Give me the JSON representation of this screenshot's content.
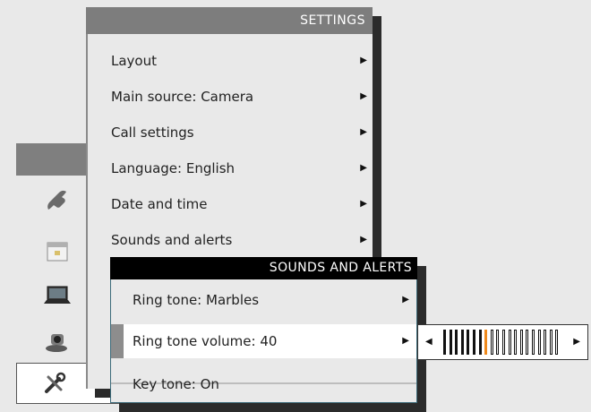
{
  "settings": {
    "title": "SETTINGS",
    "items": [
      {
        "label": "Layout"
      },
      {
        "label": "Main source: Camera"
      },
      {
        "label": "Call settings"
      },
      {
        "label": "Language: English"
      },
      {
        "label": "Date and time"
      },
      {
        "label": "Sounds and alerts"
      }
    ]
  },
  "sounds_menu": {
    "title": "SOUNDS AND ALERTS",
    "items": [
      {
        "label": "Ring tone: Marbles"
      },
      {
        "label": "Ring tone volume: 40"
      },
      {
        "label": "Key tone: On"
      }
    ],
    "selected_index": 1
  },
  "volume": {
    "value": 40,
    "level_fraction": 0.4,
    "segments": 20,
    "accent_color": "#f08a1c"
  },
  "background_menu_icons": [
    "phone-icon",
    "calendar-icon",
    "laptop-icon",
    "camera-icon",
    "tools-icon"
  ],
  "icons": {
    "arrow": "▶",
    "arrow_left": "◀"
  },
  "colors": {
    "header_gray": "#7d7d7d",
    "header_black": "#000000",
    "panel": "#e9e9e9",
    "shadow": "#2b2b2b",
    "accent": "#f08a1c"
  }
}
